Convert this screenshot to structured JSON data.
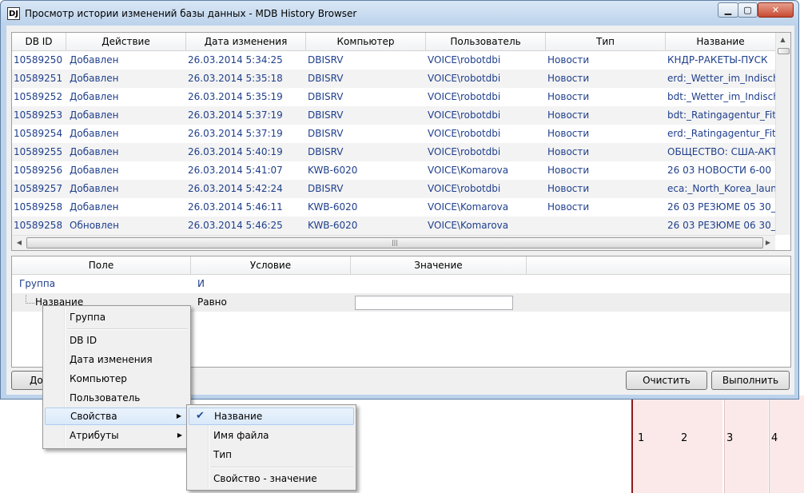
{
  "window": {
    "title": "Просмотр истории изменений базы данных  - MDB History Browser",
    "icon": "DJ"
  },
  "grid": {
    "columns": [
      "DB ID",
      "Действие",
      "Дата изменения",
      "Компьютер",
      "Пользователь",
      "Тип",
      "Название"
    ],
    "rows": [
      [
        "10589250",
        "Добавлен",
        "26.03.2014 5:34:25",
        "DBISRV",
        "VOICE\\robotdbi",
        "Новости",
        "КНДР-РАКЕТЫ-ПУСК"
      ],
      [
        "10589251",
        "Добавлен",
        "26.03.2014 5:35:18",
        "DBISRV",
        "VOICE\\robotdbi",
        "Новости",
        "erd:_Wetter_im_Indischen"
      ],
      [
        "10589252",
        "Добавлен",
        "26.03.2014 5:35:19",
        "DBISRV",
        "VOICE\\robotdbi",
        "Новости",
        "bdt:_Wetter_im_Indischen"
      ],
      [
        "10589253",
        "Добавлен",
        "26.03.2014 5:37:19",
        "DBISRV",
        "VOICE\\robotdbi",
        "Новости",
        "bdt:_Ratingagentur_Fitch_"
      ],
      [
        "10589254",
        "Добавлен",
        "26.03.2014 5:37:19",
        "DBISRV",
        "VOICE\\robotdbi",
        "Новости",
        "erd:_Ratingagentur_Fitch_"
      ],
      [
        "10589255",
        "Добавлен",
        "26.03.2014 5:40:19",
        "DBISRV",
        "VOICE\\robotdbi",
        "Новости",
        "ОБЩЕСТВО: США-АКТЕР"
      ],
      [
        "10589256",
        "Добавлен",
        "26.03.2014 5:41:07",
        "KWB-6020",
        "VOICE\\Komarova",
        "Новости",
        "26 03  НОВОСТИ 6-00"
      ],
      [
        "10589257",
        "Добавлен",
        "26.03.2014 5:42:24",
        "DBISRV",
        "VOICE\\robotdbi",
        "Новости",
        "eca:_North_Korea_launche"
      ],
      [
        "10589258",
        "Добавлен",
        "26.03.2014 5:46:11",
        "KWB-6020",
        "VOICE\\Komarova",
        "Новости",
        "26 03  РЕЗЮМЕ 05 30_"
      ],
      [
        "10589258",
        "Обновлен",
        "26.03.2014 5:46:25",
        "KWB-6020",
        "VOICE\\Komarova",
        "",
        "26 03  РЕЗЮМЕ 06 30_"
      ]
    ]
  },
  "filter": {
    "columns": [
      "Поле",
      "Условие",
      "Значение"
    ],
    "group_field": "Группа",
    "group_condition": "И",
    "row_field": "Название",
    "row_condition": "Равно",
    "row_value": ""
  },
  "buttons": {
    "add": "До",
    "clear": "Очистить",
    "run": "Выполнить"
  },
  "context_menu": {
    "items": [
      "Группа",
      "DB ID",
      "Дата изменения",
      "Компьютер",
      "Пользователь",
      "Свойства",
      "Атрибуты"
    ],
    "submenu": {
      "items": [
        "Название",
        "Имя файла",
        "Тип",
        "Свойство - значение"
      ],
      "checked": "Название"
    }
  },
  "background": {
    "column_numbers": [
      "1",
      "2",
      "3",
      "4"
    ]
  }
}
